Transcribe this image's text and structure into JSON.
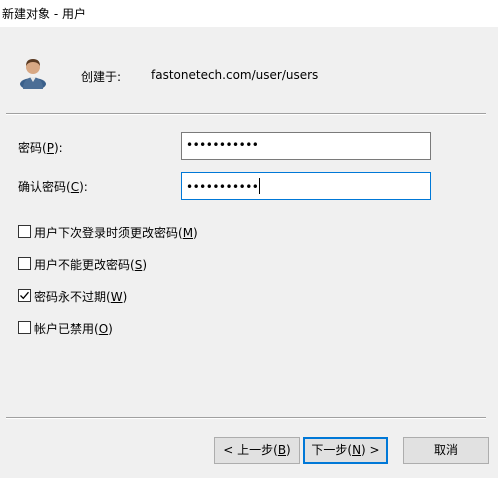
{
  "window": {
    "title": "新建对象 - 用户"
  },
  "header": {
    "icon": "user-icon",
    "create_in_label": "创建于:",
    "create_in_path": "fastonetech.com/user/users"
  },
  "fields": {
    "password": {
      "label_prefix": "密码(",
      "label_key": "P",
      "label_suffix": "):",
      "value": "•••••••••••"
    },
    "confirm": {
      "label_prefix": "确认密码(",
      "label_key": "C",
      "label_suffix": "):",
      "value": "•••••••••••"
    }
  },
  "options": [
    {
      "label_prefix": "用户下次登录时须更改密码(",
      "label_key": "M",
      "label_suffix": ")",
      "checked": false
    },
    {
      "label_prefix": "用户不能更改密码(",
      "label_key": "S",
      "label_suffix": ")",
      "checked": false
    },
    {
      "label_prefix": "密码永不过期(",
      "label_key": "W",
      "label_suffix": ")",
      "checked": true
    },
    {
      "label_prefix": "帐户已禁用(",
      "label_key": "O",
      "label_suffix": ")",
      "checked": false
    }
  ],
  "buttons": {
    "back": {
      "prefix": "< 上一步(",
      "key": "B",
      "suffix": ")"
    },
    "next": {
      "prefix": "下一步(",
      "key": "N",
      "suffix": ") >"
    },
    "cancel": {
      "label": "取消"
    }
  },
  "colors": {
    "focus_border": "#0078d7",
    "dialog_bg": "#f0f0f0",
    "button_bg": "#e1e1e1"
  }
}
